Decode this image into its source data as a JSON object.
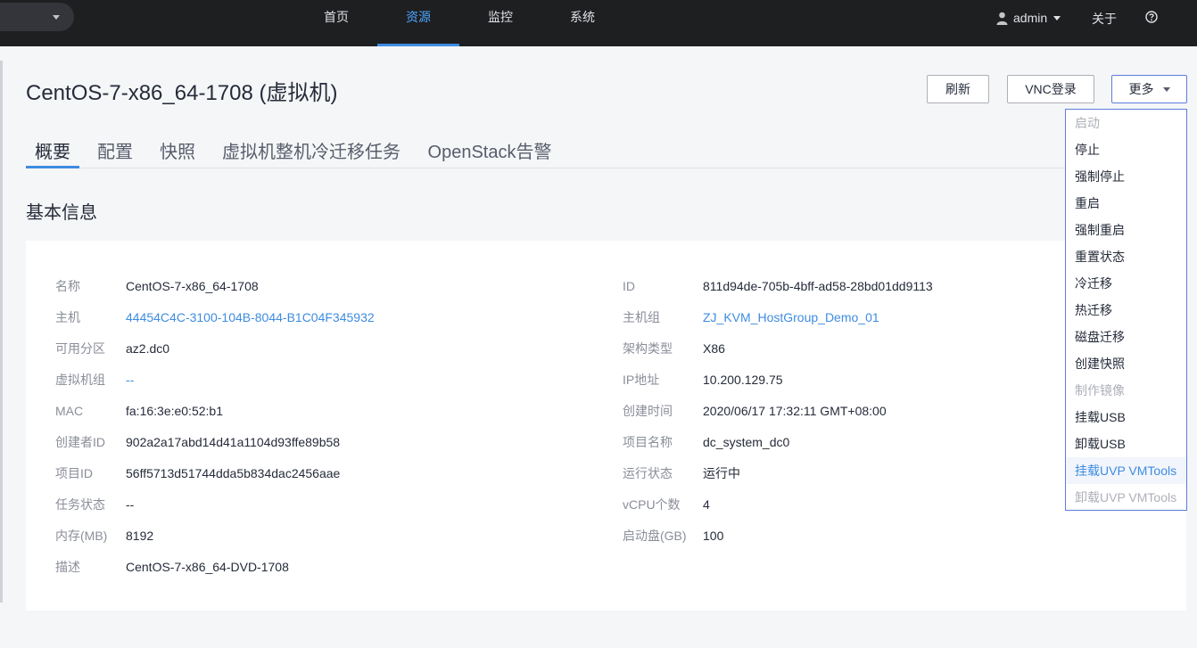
{
  "nav": {
    "items": [
      "首页",
      "资源",
      "监控",
      "系统"
    ],
    "active_index": 1,
    "user": "admin",
    "about": "关于"
  },
  "page": {
    "title": "CentOS-7-x86_64-1708 (虚拟机)",
    "buttons": {
      "refresh": "刷新",
      "vnc": "VNC登录",
      "more": "更多"
    }
  },
  "tabs": [
    "概要",
    "配置",
    "快照",
    "虚拟机整机冷迁移任务",
    "OpenStack告警"
  ],
  "section_title": "基本信息",
  "info_left": [
    {
      "label": "名称",
      "value": "CentOS-7-x86_64-1708",
      "link": false
    },
    {
      "label": "主机",
      "value": "44454C4C-3100-104B-8044-B1C04F345932",
      "link": true
    },
    {
      "label": "可用分区",
      "value": "az2.dc0",
      "link": false
    },
    {
      "label": "虚拟机组",
      "value": "--",
      "link": true
    },
    {
      "label": "MAC",
      "value": "fa:16:3e:e0:52:b1",
      "link": false
    },
    {
      "label": "创建者ID",
      "value": "902a2a17abd14d41a1104d93ffe89b58",
      "link": false
    },
    {
      "label": "项目ID",
      "value": "56ff5713d51744dda5b834dac2456aae",
      "link": false
    },
    {
      "label": "任务状态",
      "value": "--",
      "link": false
    },
    {
      "label": "内存(MB)",
      "value": "8192",
      "link": false
    },
    {
      "label": "描述",
      "value": "CentOS-7-x86_64-DVD-1708",
      "link": false
    }
  ],
  "info_right": [
    {
      "label": "ID",
      "value": "811d94de-705b-4bff-ad58-28bd01dd9113",
      "link": false
    },
    {
      "label": "主机组",
      "value": "ZJ_KVM_HostGroup_Demo_01",
      "link": true
    },
    {
      "label": "架构类型",
      "value": "X86",
      "link": false
    },
    {
      "label": "IP地址",
      "value": "10.200.129.75",
      "link": false
    },
    {
      "label": "创建时间",
      "value": "2020/06/17 17:32:11 GMT+08:00",
      "link": false
    },
    {
      "label": "项目名称",
      "value": "dc_system_dc0",
      "link": false
    },
    {
      "label": "运行状态",
      "value": "运行中",
      "link": false
    },
    {
      "label": "vCPU个数",
      "value": "4",
      "link": false
    },
    {
      "label": "启动盘(GB)",
      "value": "100",
      "link": false
    }
  ],
  "more_menu": [
    {
      "label": "启动",
      "state": "disabled"
    },
    {
      "label": "停止",
      "state": "normal"
    },
    {
      "label": "强制停止",
      "state": "normal"
    },
    {
      "label": "重启",
      "state": "normal"
    },
    {
      "label": "强制重启",
      "state": "normal"
    },
    {
      "label": "重置状态",
      "state": "normal"
    },
    {
      "label": "冷迁移",
      "state": "normal"
    },
    {
      "label": "热迁移",
      "state": "normal"
    },
    {
      "label": "磁盘迁移",
      "state": "normal"
    },
    {
      "label": "创建快照",
      "state": "normal"
    },
    {
      "label": "制作镜像",
      "state": "disabled"
    },
    {
      "label": "挂载USB",
      "state": "normal"
    },
    {
      "label": "卸载USB",
      "state": "normal"
    },
    {
      "label": "挂载UVP VMTools",
      "state": "hover"
    },
    {
      "label": "卸载UVP VMTools",
      "state": "disabled"
    }
  ],
  "colors": {
    "accent": "#3e8ce0",
    "topbar": "#1e1f21",
    "label": "#8a8e99"
  }
}
